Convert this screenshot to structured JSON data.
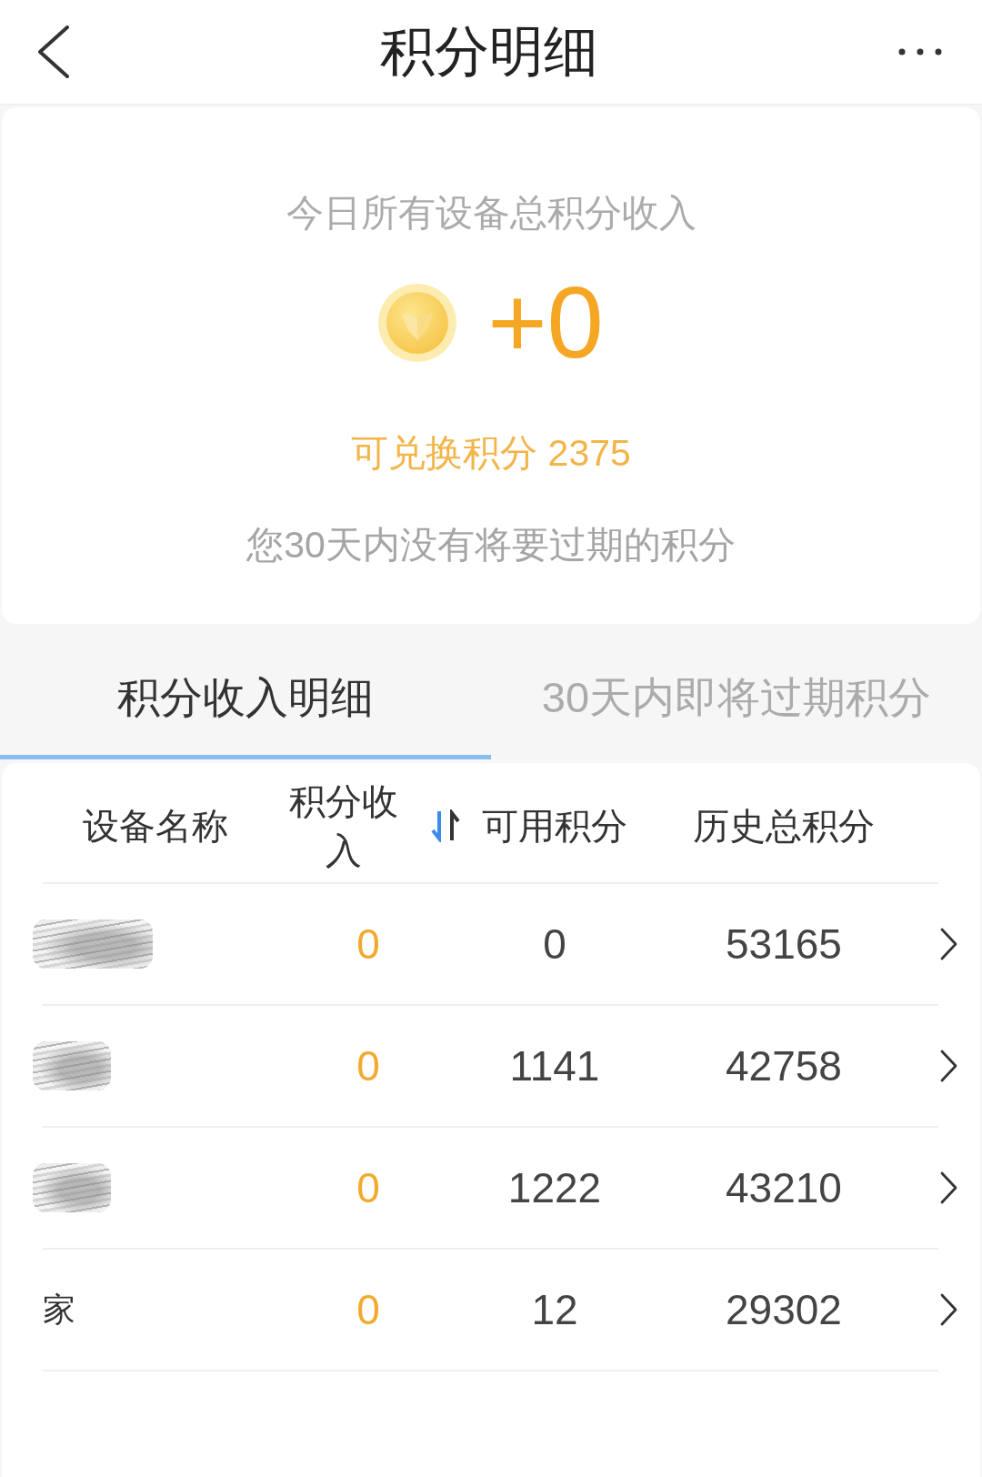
{
  "header": {
    "title": "积分明细"
  },
  "summary": {
    "caption": "今日所有设备总积分收入",
    "today_income": "+0",
    "exchangeable": "可兑换积分 2375",
    "expiry_note": "您30天内没有将要过期的积分"
  },
  "tabs": [
    {
      "label": "积分收入明细",
      "selected": true
    },
    {
      "label": "30天内即将过期积分",
      "selected": false
    }
  ],
  "table": {
    "columns": [
      {
        "label": "设备名称",
        "kind": "plain"
      },
      {
        "label": "积分收入",
        "kind": "sortable",
        "sorted": true
      },
      {
        "label": "可用积分",
        "kind": "plain"
      },
      {
        "label": "历史总积分",
        "kind": "plain"
      }
    ],
    "rows": [
      {
        "kind": "redacted",
        "income": "0",
        "available": "0",
        "total": "53165"
      },
      {
        "kind": "redacted",
        "income": "0",
        "available": "1141",
        "total": "42758"
      },
      {
        "kind": "redacted",
        "income": "0",
        "available": "1222",
        "total": "43210"
      },
      {
        "kind": "text",
        "name": "家",
        "income": "0",
        "available": "12",
        "total": "29302"
      }
    ]
  }
}
